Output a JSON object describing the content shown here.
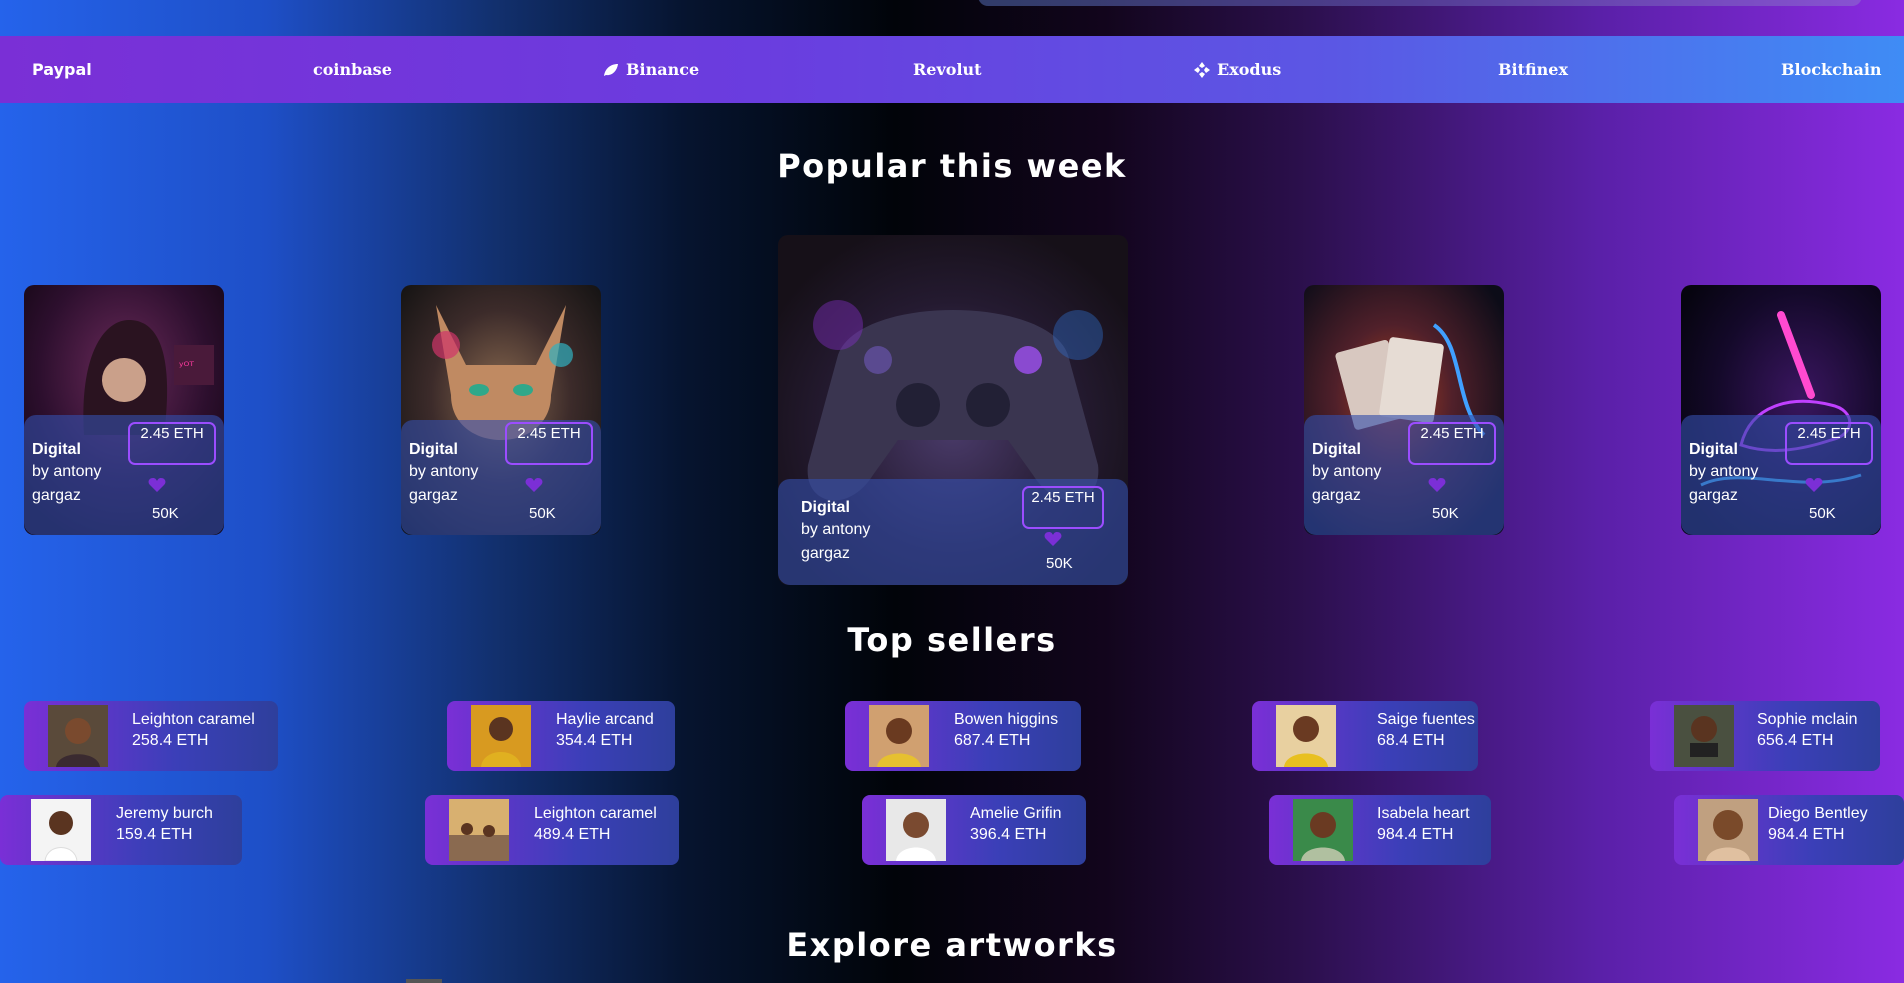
{
  "partners": [
    "Paypal",
    "coinbase",
    "Binance",
    "Revolut",
    "Exodus",
    "Bitfinex",
    "Blockchain"
  ],
  "popular": {
    "title": "Popular this week",
    "cards": [
      {
        "name": "Digital",
        "by": "by antony gargaz",
        "price": "2.45 ETH",
        "likes": "50K",
        "art": "hooded-hacker"
      },
      {
        "name": "Digital",
        "by": "by antony gargaz",
        "price": "2.45 ETH",
        "likes": "50K",
        "art": "lynx"
      },
      {
        "name": "Digital",
        "by": "by antony gargaz",
        "price": "2.45 ETH",
        "likes": "50K",
        "art": "game-controller"
      },
      {
        "name": "Digital",
        "by": "by antony gargaz",
        "price": "2.45 ETH",
        "likes": "50K",
        "art": "playing-cards"
      },
      {
        "name": "Digital",
        "by": "by antony gargaz",
        "price": "2.45 ETH",
        "likes": "50K",
        "art": "neon-hand"
      }
    ]
  },
  "sellers": {
    "title": "Top sellers",
    "items": [
      {
        "name": "Leighton caramel",
        "eth": "258.4 ETH"
      },
      {
        "name": "Haylie arcand",
        "eth": "354.4 ETH"
      },
      {
        "name": "Bowen higgins",
        "eth": "687.4 ETH"
      },
      {
        "name": "Saige fuentes",
        "eth": "68.4 ETH"
      },
      {
        "name": "Sophie mclain",
        "eth": "656.4 ETH"
      },
      {
        "name": "Jeremy burch",
        "eth": "159.4 ETH"
      },
      {
        "name": "Leighton caramel",
        "eth": "489.4 ETH"
      },
      {
        "name": "Amelie Grifin",
        "eth": "396.4 ETH"
      },
      {
        "name": "Isabela heart",
        "eth": "984.4 ETH"
      },
      {
        "name": "Diego Bentley",
        "eth": "984.4 ETH"
      }
    ]
  },
  "explore": {
    "title": "Explore artworks"
  },
  "colors": {
    "accent": "#9b4dff",
    "heart": "#7b2fd6"
  }
}
